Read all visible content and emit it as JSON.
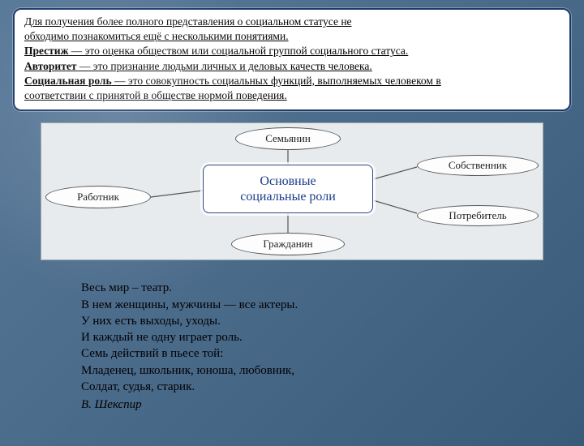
{
  "intro": {
    "line1": "Для получения более полного представления о социальном статусе не",
    "line2": "обходимо познакомиться ещё с несколькими понятиями.",
    "def1_term": "Престиж",
    "def1_rest": " — это оценка обществом или социальной группой социального статуса.",
    "def2_term": "Авторитет",
    "def2_rest": " — это признание людьми личных и деловых качеств человека.",
    "def3_term": "Социальная роль",
    "def3_rest1": " — это совокупность социальных функций, выполняемых человеком в",
    "def3_rest2": "соответствии с принятой в обществе нормой поведения."
  },
  "diagram": {
    "center1": "Основные",
    "center2": "социальные роли",
    "top": "Семьянин",
    "left": "Работник",
    "right1": "Собственник",
    "right2": "Потребитель",
    "bottom": "Гражданин"
  },
  "quote": {
    "l1": "Весь мир – театр.",
    "l2": "В нем женщины, мужчины — все актеры.",
    "l3": "У них есть выходы, уходы.",
    "l4": "И каждый не одну играет роль.",
    "l5": "Семь действий в пьесе той:",
    "l6": "Младенец, школьник, юноша, любовник,",
    "l7": "Солдат, судья, старик.",
    "author": "В. Шекспир"
  }
}
